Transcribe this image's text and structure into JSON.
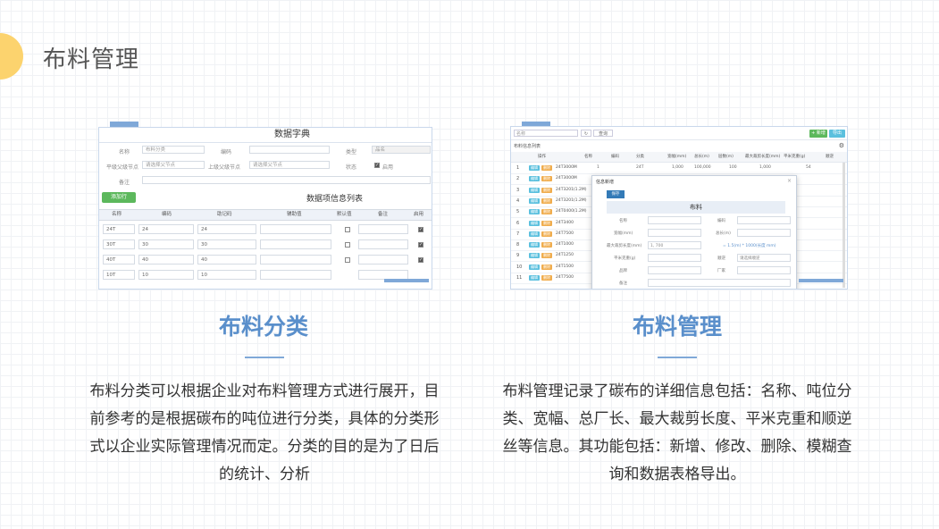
{
  "page": {
    "title": "布料管理"
  },
  "left_card": {
    "title": "布料分类",
    "description": "布料分类可以根据企业对布料管理方式进行展开，目前参考的是根据碳布的吨位进行分类，具体的分类形式以企业实际管理情况而定。分类的目的是为了日后的统计、分析",
    "shot": {
      "header": "数据字典",
      "name_label": "名称",
      "name_value": "布料分类",
      "code_label": "编码",
      "type_label": "类型",
      "type_value": "品名",
      "parent_label": "平级父级节点",
      "parent_value": "请选择父节点",
      "upper_label": "上级父级节点",
      "upper_value": "请选择父节点",
      "status_label": "状态",
      "status_value": "启用",
      "remark_label": "备注",
      "add_button": "添加行",
      "sub_title": "数据项信息列表",
      "columns": [
        "名称",
        "编码",
        "助记码",
        "辅助值",
        "默认值",
        "备注",
        "启用"
      ],
      "rows": [
        {
          "name": "24T",
          "code": "24",
          "mnemonic": "24",
          "default": false,
          "enabled": true
        },
        {
          "name": "30T",
          "code": "30",
          "mnemonic": "30",
          "default": false,
          "enabled": true
        },
        {
          "name": "40T",
          "code": "40",
          "mnemonic": "40",
          "default": false,
          "enabled": true
        },
        {
          "name": "10T",
          "code": "10",
          "mnemonic": "10",
          "default": false,
          "enabled": false
        }
      ]
    }
  },
  "right_card": {
    "title": "布料管理",
    "description": "布料管理记录了碳布的详细信息包括：名称、吨位分类、宽幅、总厂长、最大裁剪长度、平米克重和顺逆丝等信息。其功能包括：新增、修改、删除、模糊查询和数据表格导出。",
    "shot": {
      "search_placeholder": "名称",
      "search_button": "查询",
      "add_button": "+ 新增",
      "export_button": "导出",
      "list_title": "布料信息列表",
      "columns": [
        "操作",
        "名称",
        "编码",
        "分类",
        "宽幅(mm)",
        "总长(m)",
        "层数(m)",
        "最大裁剪长度(mm)",
        "平米克重(g)",
        "顺逆"
      ],
      "first_row": [
        "24T3000M",
        "1",
        "24T",
        "1,000",
        "100,000",
        "100",
        "1,000",
        "54"
      ],
      "rows": [
        {
          "n": "1",
          "code": "24T3000M"
        },
        {
          "n": "2",
          "code": "24T3000M"
        },
        {
          "n": "3",
          "code": "24T3201(1.2M)"
        },
        {
          "n": "4",
          "code": "24T3201(1.2M)"
        },
        {
          "n": "5",
          "code": "24T0400(1.2M)"
        },
        {
          "n": "6",
          "code": "24T3400"
        },
        {
          "n": "7",
          "code": "24T7500"
        },
        {
          "n": "8",
          "code": "24T1000"
        },
        {
          "n": "9",
          "code": "24T1250"
        },
        {
          "n": "10",
          "code": "24T1500"
        },
        {
          "n": "11",
          "code": "24T7500"
        }
      ],
      "edit_tag": "编辑",
      "delete_tag": "删除",
      "modal_title": "信息新增",
      "modal_save": "保存",
      "modal_form_title": "布料",
      "modal_fields": {
        "name": "名称",
        "code": "编码",
        "width": "宽幅(mm)",
        "length": "总长(m)",
        "max_cut": "最大裁剪长度(mm)",
        "max_cut_value": "1, 700",
        "max_cut_hint": "= 1.5(m) * 1000(长度 mm)",
        "weight": "平米克重(g)",
        "direction": "顺逆",
        "direction_value": "请选择顺逆",
        "supplier": "品牌",
        "factory": "厂家",
        "remark": "备注"
      }
    }
  },
  "colors": {
    "accent": "#5a8fcb",
    "circle": "#fcd36e",
    "green": "#5cb85c"
  }
}
